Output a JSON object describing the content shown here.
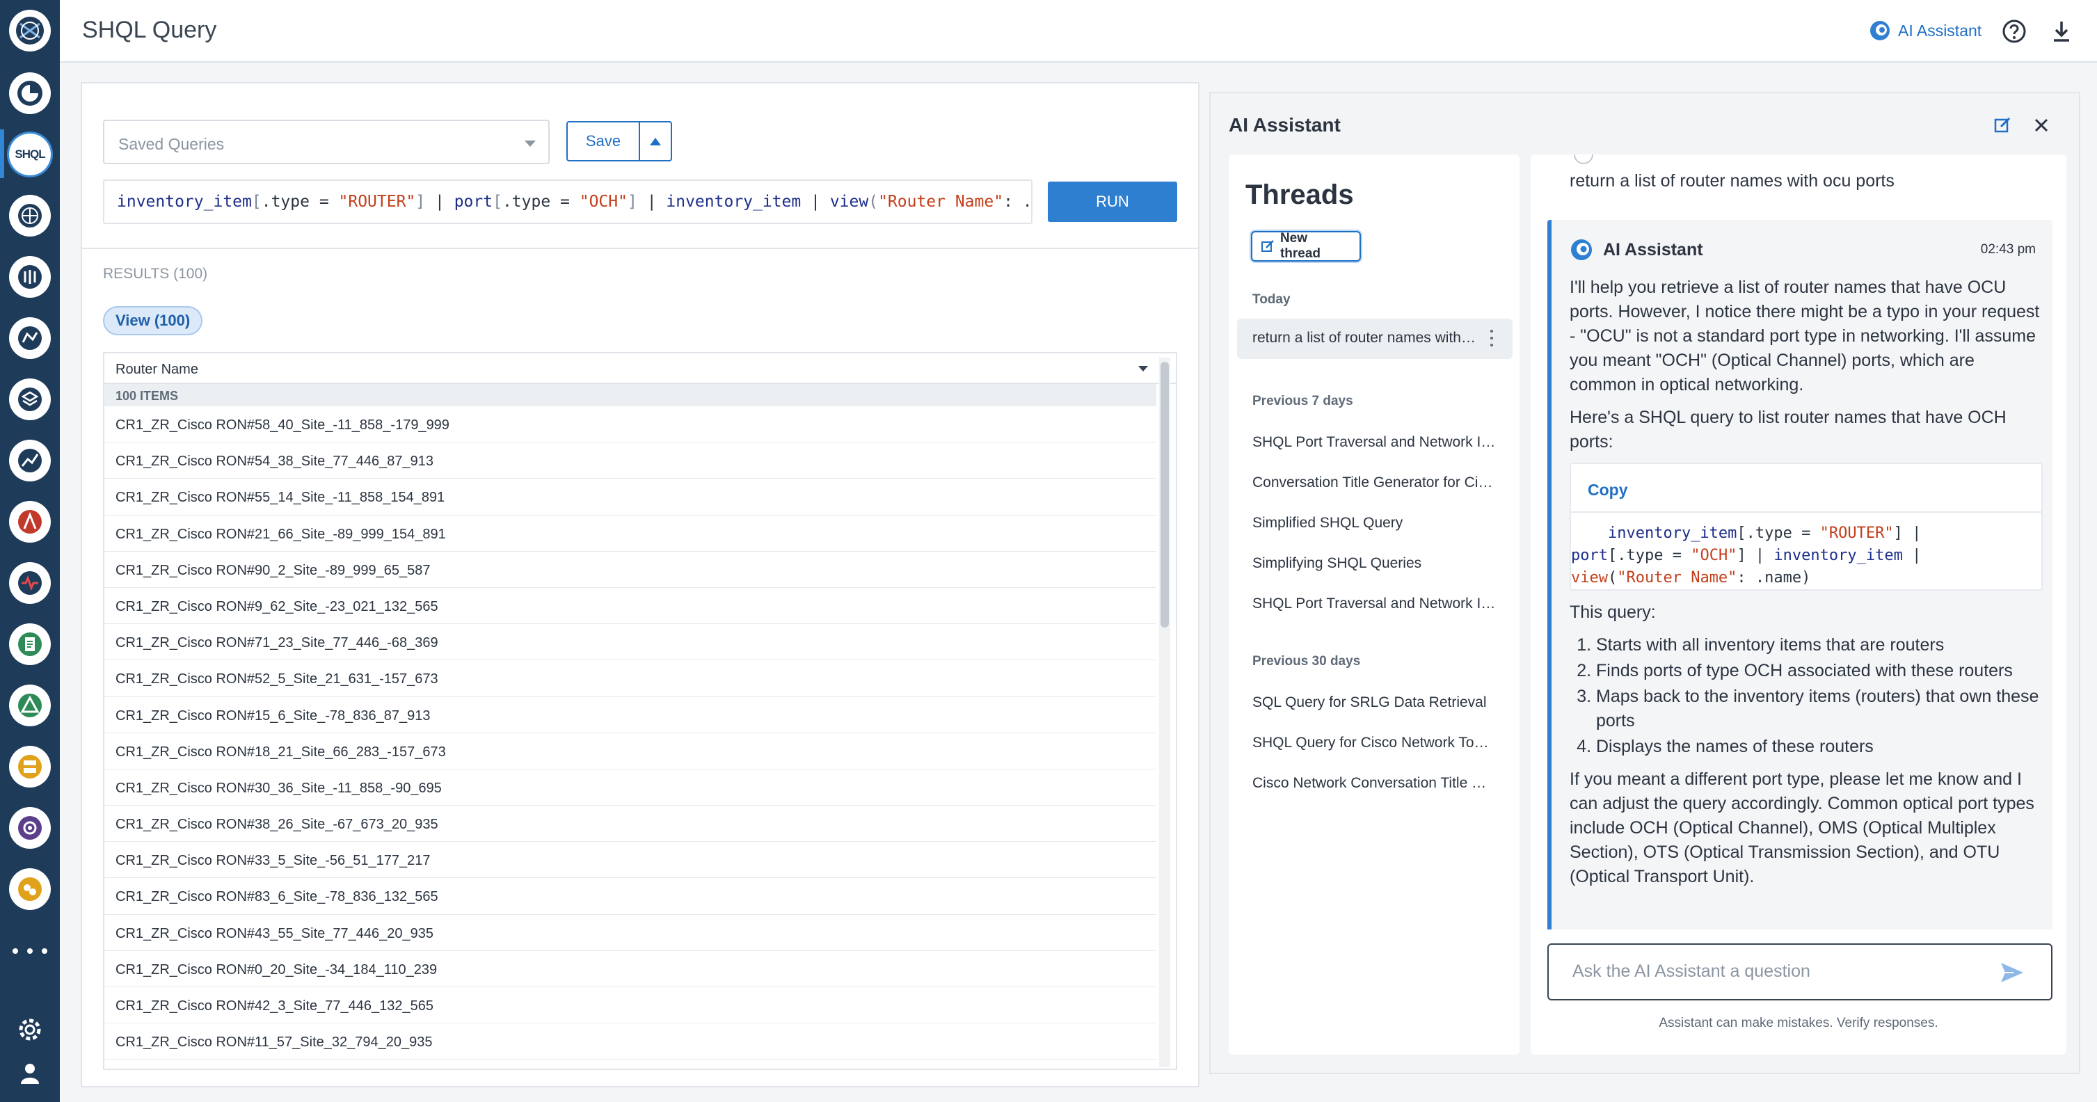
{
  "header": {
    "page_title": "SHQL Query",
    "ai_assistant_label": "AI Assistant"
  },
  "nav": {
    "shql_label": "SHQL",
    "items": [
      "logo-icon",
      "cross-launch-icon",
      "shql-icon",
      "globe-icon",
      "network-icon",
      "map-icon",
      "layers-icon",
      "chart-icon",
      "bar-icon",
      "search-icon",
      "document-icon",
      "triangle-icon",
      "server-icon",
      "circle-icon",
      "tools-icon",
      "more-icon",
      "gear-icon",
      "user-icon"
    ]
  },
  "query": {
    "saved_queries_placeholder": "Saved Queries",
    "save_label": "Save",
    "run_label": "RUN",
    "results_label": "RESULTS (100)",
    "view_pill": "View (100)"
  },
  "table": {
    "column": "Router Name",
    "items_count": "100 ITEMS",
    "rows": [
      "CR1_ZR_Cisco RON#58_40_Site_-11_858_-179_999",
      "CR1_ZR_Cisco RON#54_38_Site_77_446_87_913",
      "CR1_ZR_Cisco RON#55_14_Site_-11_858_154_891",
      "CR1_ZR_Cisco RON#21_66_Site_-89_999_154_891",
      "CR1_ZR_Cisco RON#90_2_Site_-89_999_65_587",
      "CR1_ZR_Cisco RON#9_62_Site_-23_021_132_565",
      "CR1_ZR_Cisco RON#71_23_Site_77_446_-68_369",
      "CR1_ZR_Cisco RON#52_5_Site_21_631_-157_673",
      "CR1_ZR_Cisco RON#15_6_Site_-78_836_87_913",
      "CR1_ZR_Cisco RON#18_21_Site_66_283_-157_673",
      "CR1_ZR_Cisco RON#30_36_Site_-11_858_-90_695",
      "CR1_ZR_Cisco RON#38_26_Site_-67_673_20_935",
      "CR1_ZR_Cisco RON#33_5_Site_-56_51_177_217",
      "CR1_ZR_Cisco RON#83_6_Site_-78_836_132_565",
      "CR1_ZR_Cisco RON#43_55_Site_77_446_20_935",
      "CR1_ZR_Cisco RON#0_20_Site_-34_184_110_239",
      "CR1_ZR_Cisco RON#42_3_Site_77_446_132_565",
      "CR1_ZR_Cisco RON#11_57_Site_32_794_20_935"
    ]
  },
  "ai": {
    "title": "AI Assistant",
    "threads_heading": "Threads",
    "new_thread": "New thread",
    "group_today": "Today",
    "today_items": [
      "return a list of router names with ocu ports"
    ],
    "group_7days": "Previous 7 days",
    "week_items": [
      "SHQL Port Traversal and Network Inventory",
      "Conversation Title Generator for Cisco",
      "Simplified SHQL Query",
      "Simplifying SHQL Queries",
      "SHQL Port Traversal and Network Inventory"
    ],
    "group_30days": "Previous 30 days",
    "month_items": [
      "SQL Query for SRLG Data Retrieval",
      "SHQL Query for Cisco Network Topology",
      "Cisco Network Conversation Title Generator"
    ],
    "user_message": "return a list of router names with ocu ports",
    "assistant_name": "AI Assistant",
    "assistant_time": "02:43 pm",
    "para1": "I'll help you retrieve a list of router names that have OCU ports. However, I notice there might be a typo in your request - \"OCU\" is not a standard port type in networking. I'll assume you meant \"OCH\" (Optical Channel) ports, which are common in optical networking.",
    "para2": "Here's a SHQL query to list router names that have OCH ports:",
    "copy_label": "Copy",
    "para3": "This query:",
    "steps": [
      "Starts with all inventory items that are routers",
      "Finds ports of type OCH associated with these routers",
      "Maps back to the inventory items (routers) that own these ports",
      "Displays the names of these routers"
    ],
    "para4": "If you meant a different port type, please let me know and I can adjust the query accordingly. Common optical port types include OCH (Optical Channel), OMS (Optical Multiplex Section), OTS (Optical Transmission Section), and OTU (Optical Transport Unit).",
    "ask_placeholder": "Ask the AI Assistant a question",
    "disclaimer": "Assistant can make mistakes. Verify responses."
  }
}
